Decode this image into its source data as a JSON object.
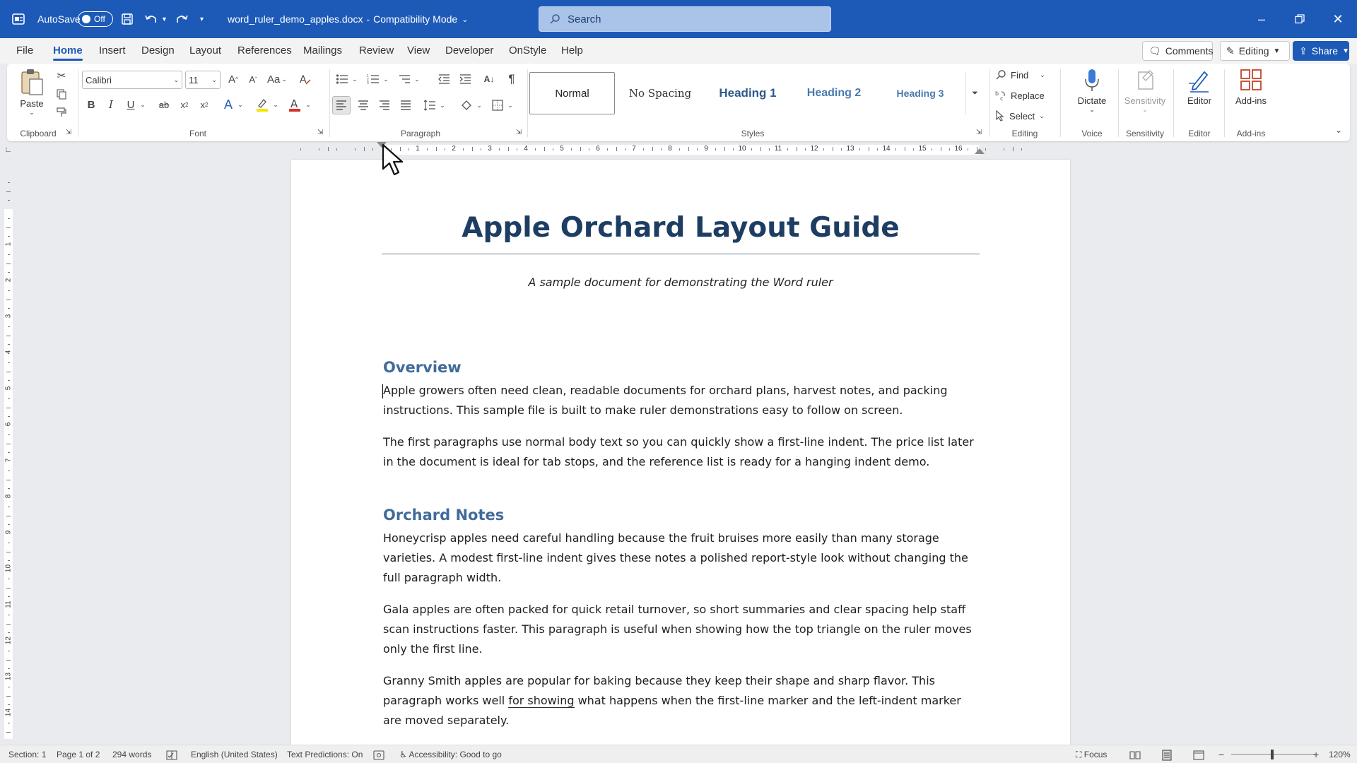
{
  "titlebar": {
    "autosave_label": "AutoSave",
    "autosave_state": "Off",
    "doc_name": "word_ruler_demo_apples.docx",
    "separator": "-",
    "mode": "Compatibility Mode",
    "search_placeholder": "Search"
  },
  "tabs": [
    "File",
    "Home",
    "Insert",
    "Design",
    "Layout",
    "References",
    "Mailings",
    "Review",
    "View",
    "Developer",
    "OnStyle",
    "Help"
  ],
  "active_tab": "Home",
  "tab_buttons": {
    "comments": "Comments",
    "editing": "Editing",
    "share": "Share"
  },
  "ribbon": {
    "groups": {
      "clipboard": "Clipboard",
      "font": "Font",
      "paragraph": "Paragraph",
      "styles": "Styles",
      "editing": "Editing",
      "voice": "Voice",
      "sensitivity": "Sensitivity",
      "editor": "Editor",
      "addins": "Add-ins"
    },
    "paste": "Paste",
    "font_name": "Calibri",
    "font_size": "11",
    "case_label": "Aa",
    "styles": [
      "Normal",
      "No Spacing",
      "Heading 1",
      "Heading 2",
      "Heading 3"
    ],
    "find": "Find",
    "replace": "Replace",
    "select": "Select",
    "dictate": "Dictate",
    "sensitivity": "Sensitivity",
    "editor": "Editor",
    "addins": "Add-ins"
  },
  "ruler": {
    "h_numbers": [
      "1",
      "2",
      "3",
      "4",
      "5",
      "6",
      "7",
      "8",
      "9",
      "10",
      "11",
      "12",
      "13",
      "14",
      "15",
      "16"
    ],
    "v_numbers": [
      "1",
      "2",
      "3",
      "4",
      "5",
      "6",
      "7",
      "8",
      "9",
      "10",
      "11",
      "12",
      "13",
      "14"
    ]
  },
  "document": {
    "title": "Apple Orchard Layout Guide",
    "subtitle": "A sample document for demonstrating the Word ruler",
    "sections": [
      {
        "heading": "Overview",
        "paragraphs": [
          "Apple growers often need clean, readable documents for orchard plans, harvest notes, and packing instructions. This sample file is built to make ruler demonstrations easy to follow on screen.",
          "The first paragraphs use normal body text so you can quickly show a first-line indent. The price list later in the document is ideal for tab stops, and the reference list is ready for a hanging indent demo."
        ]
      },
      {
        "heading": "Orchard Notes",
        "paragraphs": [
          "Honeycrisp apples need careful handling because the fruit bruises more easily than many storage varieties. A modest first-line indent gives these notes a polished report-style look without changing the full paragraph width.",
          "Gala apples are often packed for quick retail turnover, so short summaries and clear spacing help staff scan instructions faster. This paragraph is useful when showing how the top triangle on the ruler moves only the first line."
        ],
        "last_paragraph": {
          "before": "Granny Smith apples are popular for baking because they keep their shape and sharp flavor. This paragraph works well ",
          "underlined": "for showing",
          "after": " what happens when the first-line marker and the left-indent marker are moved separately."
        }
      }
    ]
  },
  "statusbar": {
    "section": "Section: 1",
    "page": "Page 1 of 2",
    "words": "294 words",
    "language": "English (United States)",
    "predictions": "Text Predictions: On",
    "accessibility": "Accessibility: Good to go",
    "focus": "Focus",
    "zoom": "120%"
  },
  "colors": {
    "titlebar": "#1d5ab8",
    "heading": "#416b9a",
    "title": "#1d3d63"
  }
}
